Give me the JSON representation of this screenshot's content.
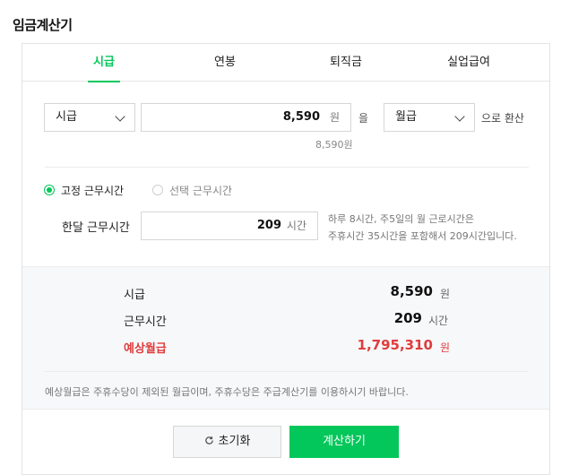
{
  "title": "임금계산기",
  "tabs": [
    {
      "label": "시급"
    },
    {
      "label": "연봉"
    },
    {
      "label": "퇴직금"
    },
    {
      "label": "실업급여"
    }
  ],
  "convert": {
    "from_select": "시급",
    "amount": "8,590",
    "amount_unit": "원",
    "particle": "을",
    "to_select": "월급",
    "suffix": "으로 환산",
    "amount_echo": "8,590원"
  },
  "hours": {
    "fixed_label": "고정 근무시간",
    "select_label": "선택 근무시간",
    "month_label": "한달 근무시간",
    "value": "209",
    "unit": "시간",
    "help_line1": "하루 8시간, 주5일의 월 근로시간은",
    "help_line2": "주휴시간 35시간을 포함해서 209시간입니다."
  },
  "result": {
    "wage_label": "시급",
    "wage_value": "8,590",
    "wage_unit": "원",
    "hours_label": "근무시간",
    "hours_value": "209",
    "hours_unit": "시간",
    "expected_label": "예상월급",
    "expected_value": "1,795,310",
    "expected_unit": "원",
    "note": "예상월급은 주휴수당이 제외된 월급이며, 주휴수당은 주급계산기를 이용하시기 바랍니다."
  },
  "buttons": {
    "reset": "초기화",
    "calc": "계산하기"
  },
  "colors": {
    "accent": "#03c75a",
    "highlight": "#e03c3c"
  }
}
